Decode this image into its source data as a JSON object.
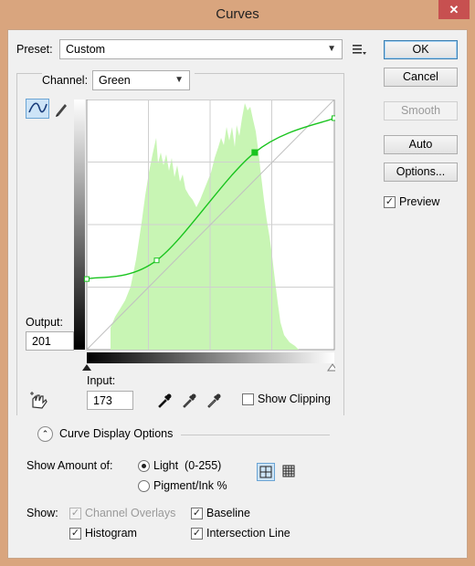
{
  "window": {
    "title": "Curves",
    "close_label": "✕"
  },
  "preset": {
    "label": "Preset:",
    "value": "Custom"
  },
  "channel": {
    "label": "Channel:",
    "value": "Green"
  },
  "buttons": {
    "ok": "OK",
    "cancel": "Cancel",
    "smooth": "Smooth",
    "auto": "Auto",
    "options": "Options..."
  },
  "preview": {
    "label": "Preview",
    "checked": true
  },
  "output": {
    "label": "Output:",
    "value": "201"
  },
  "input": {
    "label": "Input:",
    "value": "173"
  },
  "show_clipping": {
    "label": "Show Clipping",
    "checked": false
  },
  "curve_display_options": {
    "label": "Curve Display Options"
  },
  "show_amount": {
    "label": "Show Amount of:",
    "light_label": "Light  (0-255)",
    "pigment_label": "Pigment/Ink %",
    "selected": "light"
  },
  "show": {
    "label": "Show:",
    "channel_overlays": "Channel Overlays",
    "baseline": "Baseline",
    "histogram": "Histogram",
    "intersection_line": "Intersection Line"
  },
  "icons": [
    "curve-tool-icon",
    "pencil-icon",
    "presets-menu-icon",
    "targeted-adjust-hand-icon",
    "black-eyedropper-icon",
    "gray-eyedropper-icon",
    "white-eyedropper-icon",
    "collapse-chevron-icon",
    "simple-grid-icon",
    "detailed-grid-icon"
  ],
  "colors": {
    "histogram": "#c8f5b4",
    "curve": "#19c41e",
    "accent": "#3c7fb1",
    "titlebar": "#d9a57e"
  },
  "curve_points": [
    {
      "input": 0,
      "output": 72
    },
    {
      "input": 72,
      "output": 91
    },
    {
      "input": 173,
      "output": 201
    },
    {
      "input": 255,
      "output": 236
    }
  ]
}
